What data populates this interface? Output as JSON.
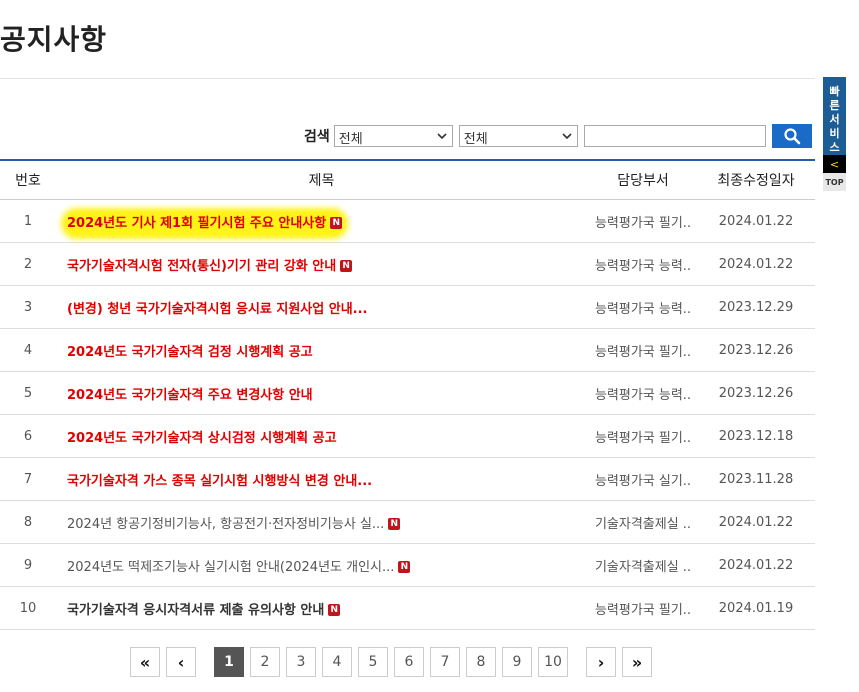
{
  "page": {
    "title": "공지사항"
  },
  "search": {
    "label": "검색",
    "select1_value": "전체",
    "select2_value": "전체",
    "input_value": ""
  },
  "table": {
    "headers": {
      "num": "번호",
      "title": "제목",
      "dept": "담당부서",
      "date": "최종수정일자"
    },
    "rows": [
      {
        "num": "1",
        "title": "2024년도 기사 제1회 필기시험 주요 안내사항",
        "dept": "능력평가국 필기..",
        "date": "2024.01.22"
      },
      {
        "num": "2",
        "title": "국가기술자격시험 전자(통신)기기 관리 강화 안내",
        "dept": "능력평가국 능력..",
        "date": "2024.01.22"
      },
      {
        "num": "3",
        "title": "(변경) 청년 국가기술자격시험 응시료 지원사업 안내...",
        "dept": "능력평가국 능력..",
        "date": "2023.12.29"
      },
      {
        "num": "4",
        "title": "2024년도 국가기술자격 검정 시행계획 공고",
        "dept": "능력평가국 필기..",
        "date": "2023.12.26"
      },
      {
        "num": "5",
        "title": "2024년도 국가기술자격 주요 변경사항 안내",
        "dept": "능력평가국 능력..",
        "date": "2023.12.26"
      },
      {
        "num": "6",
        "title": "2024년도 국가기술자격 상시검정 시행계획 공고",
        "dept": "능력평가국 필기..",
        "date": "2023.12.18"
      },
      {
        "num": "7",
        "title": "국가기술자격 가스 종목 실기시험 시행방식 변경 안내...",
        "dept": "능력평가국 실기..",
        "date": "2023.11.28"
      },
      {
        "num": "8",
        "title": "2024년 항공기정비기능사, 항공전기·전자정비기능사 실...",
        "dept": "기술자격출제실 ..",
        "date": "2024.01.22"
      },
      {
        "num": "9",
        "title": "2024년도 떡제조기능사 실기시험 안내(2024년도 개인시...",
        "dept": "기술자격출제실 ..",
        "date": "2024.01.22"
      },
      {
        "num": "10",
        "title": "국가기술자격 응시자격서류 제출 유의사항 안내",
        "dept": "능력평가국 필기..",
        "date": "2024.01.19"
      }
    ],
    "new_badge": "N"
  },
  "pagination": {
    "first": "«",
    "prev": "‹",
    "next": "›",
    "last": "»",
    "pages": [
      "1",
      "2",
      "3",
      "4",
      "5",
      "6",
      "7",
      "8",
      "9",
      "10"
    ],
    "current": "1"
  },
  "quick_menu": {
    "label": "빠른서비스",
    "toggle": "<",
    "top": "TOP"
  },
  "colors": {
    "accent_blue": "#1a6bc8",
    "notice_red": "#e10000",
    "highlight": "#fff31a",
    "quick_bg": "#1d5d96"
  }
}
